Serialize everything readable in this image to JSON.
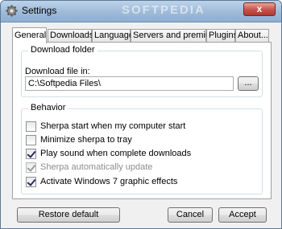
{
  "window": {
    "title": "Settings",
    "watermark": "SOFTPEDIA",
    "close_label": "x"
  },
  "tabs": [
    {
      "label": "General",
      "active": true
    },
    {
      "label": "Downloads",
      "active": false
    },
    {
      "label": "Language",
      "active": false
    },
    {
      "label": "Servers and premium",
      "active": false
    },
    {
      "label": "Plugins",
      "active": false
    },
    {
      "label": "About...",
      "active": false
    }
  ],
  "download_folder": {
    "group_label": "Download folder",
    "field_label": "Download file in:",
    "path_value": "C:\\Softpedia Files\\",
    "browse_label": "..."
  },
  "behavior": {
    "group_label": "Behavior",
    "options": [
      {
        "label": "Sherpa start when my computer start",
        "checked": false,
        "disabled": false
      },
      {
        "label": "Minimize sherpa to tray",
        "checked": false,
        "disabled": false
      },
      {
        "label": "Play sound when complete downloads",
        "checked": true,
        "disabled": false
      },
      {
        "label": "Sherpa automatically update",
        "checked": true,
        "disabled": true
      },
      {
        "label": "Activate Windows 7 graphic effects",
        "checked": true,
        "disabled": false
      }
    ]
  },
  "footer": {
    "restore_label": "Restore default",
    "cancel_label": "Cancel",
    "accept_label": "Accept"
  }
}
